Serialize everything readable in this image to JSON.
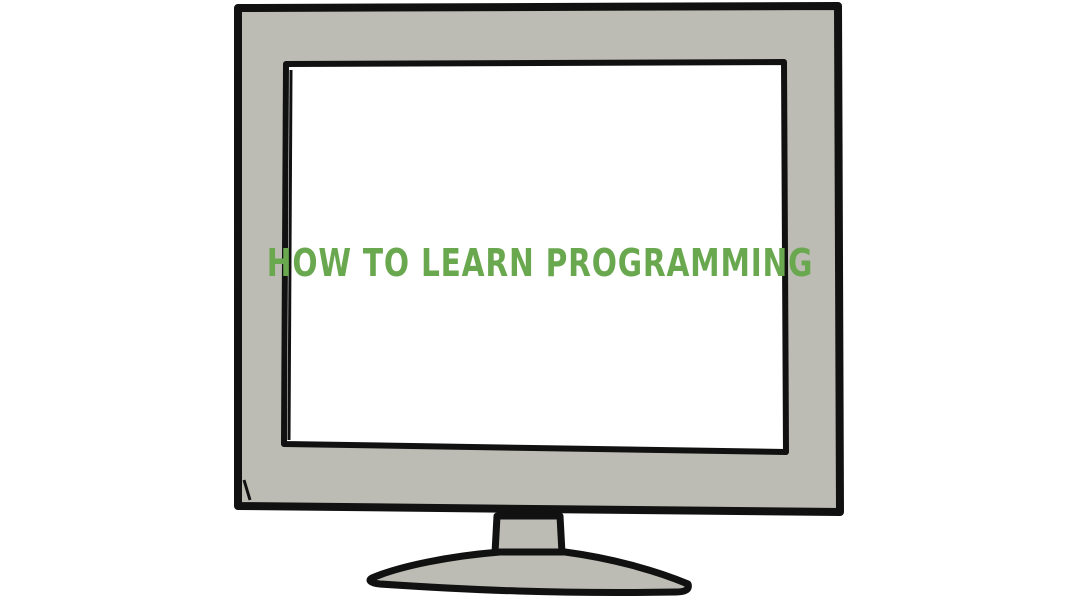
{
  "screen": {
    "title": "HOW TO LEARN PROGRAMMING"
  },
  "colors": {
    "title_green": "#6aa84f",
    "bezel_gray": "#bdbcb4",
    "outline_black": "#111111",
    "screen_white": "#ffffff"
  }
}
